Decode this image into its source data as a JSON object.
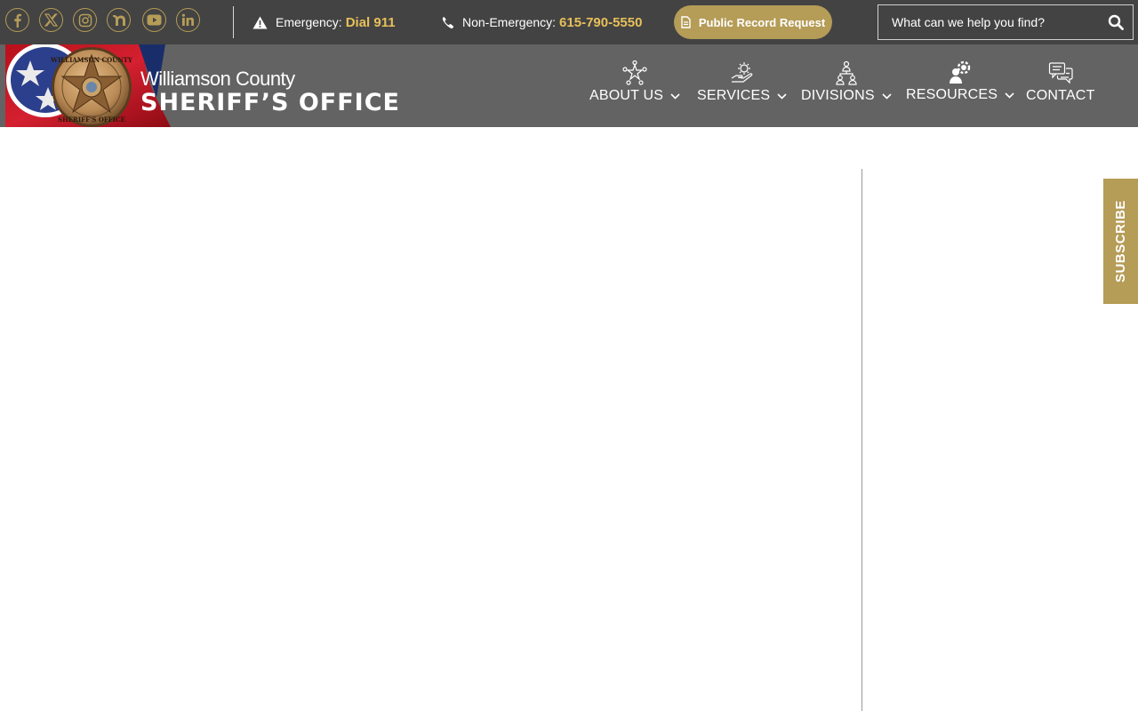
{
  "social": [
    {
      "name": "facebook-icon"
    },
    {
      "name": "x-icon"
    },
    {
      "name": "instagram-icon"
    },
    {
      "name": "nextdoor-icon"
    },
    {
      "name": "youtube-icon"
    },
    {
      "name": "linkedin-icon"
    }
  ],
  "contact": {
    "emergency_label": "Emergency:",
    "emergency_value": "Dial 911",
    "nonemergency_label": "Non-Emergency:",
    "nonemergency_value": "615-790-5550"
  },
  "record_button": "Public Record Request",
  "search": {
    "placeholder": "What can we help you find?"
  },
  "brand": {
    "county": "Williamson County",
    "office": "SHERIFF’S OFFICE",
    "seal_top": "WILLIAMSON COUNTY",
    "seal_bottom": "SHERIFF'S OFFICE"
  },
  "nav": [
    {
      "label": "ABOUT US",
      "icon": "star-network-icon",
      "dropdown": true
    },
    {
      "label": "SERVICES",
      "icon": "hand-gear-icon",
      "dropdown": true
    },
    {
      "label": "DIVISIONS",
      "icon": "org-chart-icon",
      "dropdown": true
    },
    {
      "label": "RESOURCES",
      "icon": "people-gear-icon",
      "dropdown": true
    },
    {
      "label": "CONTACT",
      "icon": "chat-bubbles-icon",
      "dropdown": false
    }
  ],
  "subscribe": "SUBSCRIBE",
  "colors": {
    "topbar": "#434343",
    "header": "#636363",
    "gold": "#b59c57",
    "highlight": "#e8c05a"
  }
}
